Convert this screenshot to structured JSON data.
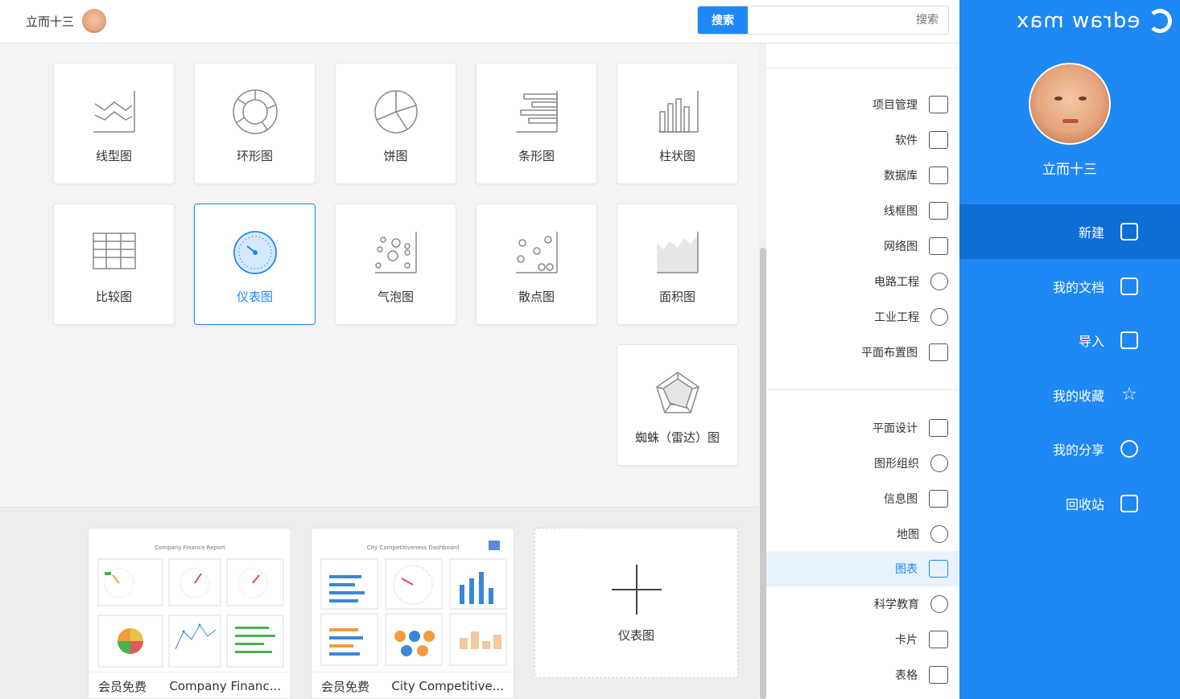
{
  "app": {
    "logo_text": "edraw max",
    "user_name": "立而十三"
  },
  "header": {
    "user_name": "立而十三",
    "search_button": "搜索",
    "search_placeholder": "搜索"
  },
  "nav": {
    "items": [
      {
        "label": "新建",
        "icon": "new-file-icon",
        "active": true
      },
      {
        "label": "我的文档",
        "icon": "document-icon",
        "active": false
      },
      {
        "label": "导入",
        "icon": "import-icon",
        "active": false
      },
      {
        "label": "我的收藏",
        "icon": "star-icon",
        "active": false
      },
      {
        "label": "我的分享",
        "icon": "share-icon",
        "active": false
      },
      {
        "label": "回收站",
        "icon": "trash-icon",
        "active": false
      }
    ]
  },
  "categories": {
    "group1": [
      {
        "label": "项目管理",
        "icon": "gantt-icon"
      },
      {
        "label": "软件",
        "icon": "hierarchy-icon"
      },
      {
        "label": "数据库",
        "icon": "database-icon"
      },
      {
        "label": "线框图",
        "icon": "wireframe-icon"
      },
      {
        "label": "网络图",
        "icon": "network-icon"
      },
      {
        "label": "电路工程",
        "icon": "circuit-icon"
      },
      {
        "label": "工业工程",
        "icon": "industry-icon"
      },
      {
        "label": "平面布置图",
        "icon": "floorplan-icon"
      }
    ],
    "group2": [
      {
        "label": "平面设计",
        "icon": "image-icon"
      },
      {
        "label": "图形组织",
        "icon": "snowflake-icon"
      },
      {
        "label": "信息图",
        "icon": "infographic-icon"
      },
      {
        "label": "地图",
        "icon": "map-pin-icon"
      },
      {
        "label": "图表",
        "icon": "bar-chart-icon",
        "active": true
      },
      {
        "label": "科学教育",
        "icon": "atom-icon"
      },
      {
        "label": "卡片",
        "icon": "card-icon"
      },
      {
        "label": "表格",
        "icon": "table-icon"
      }
    ]
  },
  "chart_types": [
    {
      "label": "柱状图",
      "icon": "column-chart-icon"
    },
    {
      "label": "条形图",
      "icon": "bar-chart-icon"
    },
    {
      "label": "饼图",
      "icon": "pie-chart-icon"
    },
    {
      "label": "环形图",
      "icon": "donut-chart-icon"
    },
    {
      "label": "线型图",
      "icon": "line-chart-icon"
    },
    {
      "label": "面积图",
      "icon": "area-chart-icon"
    },
    {
      "label": "散点图",
      "icon": "scatter-chart-icon"
    },
    {
      "label": "气泡图",
      "icon": "bubble-chart-icon"
    },
    {
      "label": "仪表图",
      "icon": "gauge-chart-icon",
      "selected": true
    },
    {
      "label": "比较图",
      "icon": "comparison-chart-icon"
    },
    {
      "label": "蜘蛛（雷达）图",
      "icon": "radar-chart-icon"
    }
  ],
  "templates": [
    {
      "title": "City Competitive...",
      "badge": "会员免费",
      "preview_title": "City Competitiveness Dashboard"
    },
    {
      "title": "Company Financ...",
      "badge": "会员免费",
      "preview_title": "Company Finance Report"
    }
  ],
  "new_card": {
    "label": "仪表图"
  },
  "colors": {
    "accent": "#1e88f5",
    "nav_active": "#0d6fd6",
    "category_active_bg": "#e8f2fd"
  }
}
